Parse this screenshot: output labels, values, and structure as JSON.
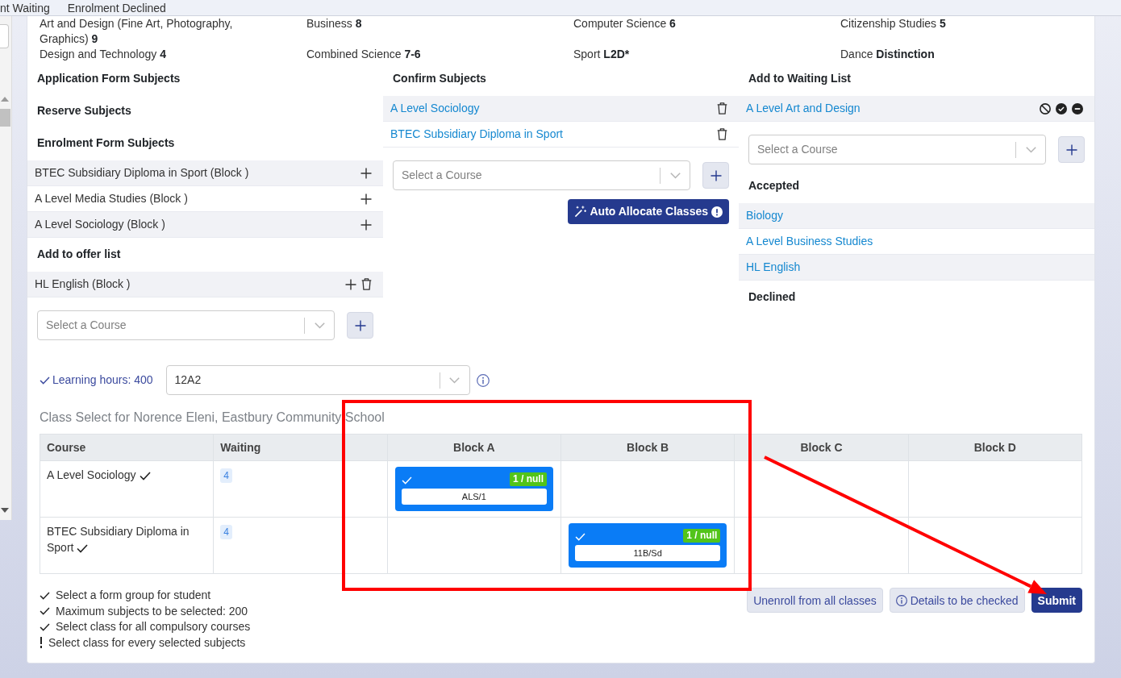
{
  "tabs": [
    {
      "label": "nt Waiting",
      "selected": false
    },
    {
      "label": "Enrolment Declined",
      "selected": false
    }
  ],
  "grades": [
    {
      "subject": "Art and Design (Fine Art, Photography, Graphics)",
      "grade": "9"
    },
    {
      "subject": "Business",
      "grade": "8"
    },
    {
      "subject": "Computer Science",
      "grade": "6"
    },
    {
      "subject": "Citizenship Studies",
      "grade": "5"
    },
    {
      "subject": "Design and Technology",
      "grade": "4"
    },
    {
      "subject": "Combined Science",
      "grade": "7-6"
    },
    {
      "subject": "Sport",
      "grade": "L2D*"
    },
    {
      "subject": "Dance",
      "grade": "Distinction"
    }
  ],
  "panels": [
    {
      "sections": [
        {
          "title": "Application Form Subjects"
        },
        {
          "title": "Reserve Subjects"
        },
        {
          "title": "Enrolment Form Subjects",
          "items": [
            {
              "label": "BTEC Subsidiary Diploma in Sport (Block )",
              "kind": "plain",
              "actions": [
                {
                  "kind": "add"
                }
              ]
            },
            {
              "label": "A Level Media Studies (Block )",
              "kind": "plain",
              "actions": [
                {
                  "kind": "add"
                }
              ]
            },
            {
              "label": "A Level Sociology (Block )",
              "kind": "plain",
              "actions": [
                {
                  "kind": "add"
                }
              ]
            }
          ]
        },
        {
          "title": "Add to offer list",
          "items": [
            {
              "label": "HL English (Block )",
              "kind": "plain",
              "actions": [
                {
                  "kind": "add"
                },
                {
                  "kind": "delete"
                }
              ]
            }
          ],
          "course_select": {
            "placeholder": "Select a Course"
          }
        }
      ]
    },
    {
      "sections": [
        {
          "title": "Confirm Subjects",
          "items": [
            {
              "label": "A Level Sociology",
              "kind": "link",
              "actions": [
                {
                  "kind": "delete"
                }
              ]
            },
            {
              "label": "BTEC Subsidiary Diploma in Sport",
              "kind": "link",
              "actions": [
                {
                  "kind": "delete"
                }
              ]
            }
          ],
          "course_select": {
            "placeholder": "Select a Course"
          },
          "button": {
            "label": "Auto Allocate Classes"
          }
        }
      ]
    },
    {
      "sections": [
        {
          "title": "Add to Waiting List",
          "items": [
            {
              "label": "A Level Art and Design",
              "kind": "link",
              "actions": [
                {
                  "kind": "decline"
                },
                {
                  "kind": "accept"
                },
                {
                  "kind": "remove"
                }
              ]
            }
          ],
          "course_select": {
            "placeholder": "Select a Course"
          }
        },
        {
          "title": "Accepted",
          "items": [
            {
              "label": "Biology",
              "kind": "link"
            },
            {
              "label": "A Level Business Studies",
              "kind": "link"
            },
            {
              "label": "HL English",
              "kind": "link"
            }
          ]
        },
        {
          "title": "Declined"
        }
      ]
    }
  ],
  "learning_hours": {
    "label": "Learning hours: 400",
    "met": true
  },
  "form_group": {
    "value": "12A2"
  },
  "class_select": {
    "title": "Class Select for Norence Eleni, Eastbury Community School",
    "columns": [
      "Course",
      "Waiting",
      "Block A",
      "Block B",
      "Block C",
      "Block D"
    ],
    "rows": [
      {
        "course": "A Level Sociology",
        "confirmed": true,
        "waiting": "4",
        "blocks": [
          {
            "kind": "class",
            "code": "ALS/1",
            "count": "1 / null",
            "checked": true
          },
          {
            "kind": "empty"
          },
          {
            "kind": "empty"
          },
          {
            "kind": "empty"
          }
        ]
      },
      {
        "course": "BTEC Subsidiary Diploma in Sport",
        "confirmed": true,
        "waiting": "4",
        "blocks": [
          {
            "kind": "empty"
          },
          {
            "kind": "class",
            "code": "11B/Sd",
            "count": "1 / null",
            "checked": true
          },
          {
            "kind": "empty"
          },
          {
            "kind": "empty"
          }
        ]
      }
    ]
  },
  "requirements": [
    {
      "text": "Select a form group for student",
      "met": true
    },
    {
      "text": "Maximum subjects to be selected: 200",
      "met": true
    },
    {
      "text": "Select class for all compulsory courses",
      "met": true
    },
    {
      "text": "Select class for every selected subjects",
      "met": false
    }
  ],
  "buttons": [
    {
      "label": "Unenroll from all classes",
      "kind": "unenroll"
    },
    {
      "label": "Details to be checked",
      "kind": "details"
    },
    {
      "label": "Submit",
      "kind": "submit"
    }
  ],
  "annotations": [
    {
      "kind": "rectangle"
    },
    {
      "kind": "arrow"
    }
  ]
}
